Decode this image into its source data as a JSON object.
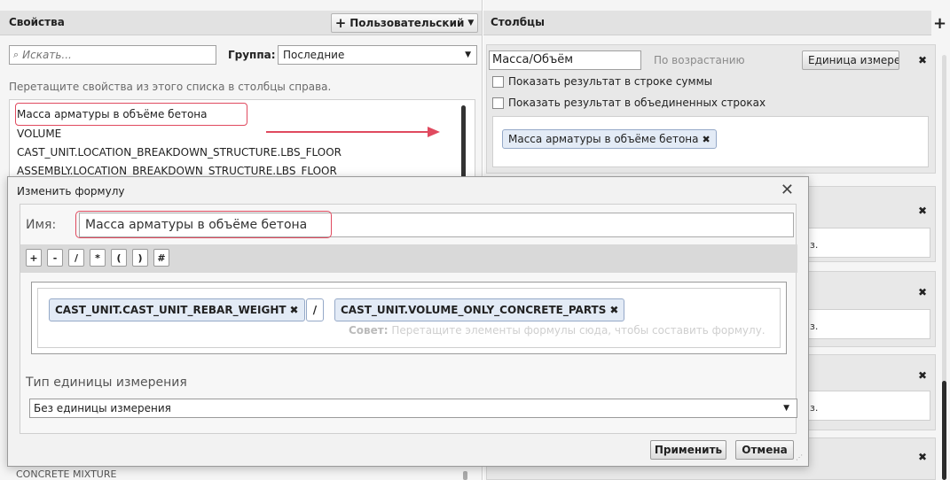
{
  "left": {
    "title": "Свойства",
    "custom_button": "Пользовательский",
    "search_placeholder": "Искать...",
    "group_label": "Группа:",
    "group_value": "Последние",
    "hint": "Перетащите свойства из этого списка в столбцы справа.",
    "items": [
      "Масса арматуры в объёме бетона",
      "VOLUME",
      "CAST_UNIT.LOCATION_BREAKDOWN_STRUCTURE.LBS_FLOOR",
      "ASSEMBLY.LOCATION_BREAKDOWN_STRUCTURE.LBS_FLOOR"
    ],
    "bottom_item": "CONCRETE MIXTURE"
  },
  "right": {
    "title": "Столбцы",
    "add_icon": "+",
    "column": {
      "name": "Масса/Объём",
      "sort": "По возрастанию",
      "unit_button": "Единица измере",
      "show_sum": "Показать результат в строке суммы",
      "show_merged": "Показать результат в объединенных строках",
      "chip": "Масса арматуры в объёме бетона"
    },
    "partial_cells": [
      "з.",
      "з.",
      "з."
    ]
  },
  "dialog": {
    "title": "Изменить формулу",
    "name_label": "Имя:",
    "name_value": "Масса арматуры в объёме бетона",
    "operators": [
      "+",
      "-",
      "/",
      "*",
      "(",
      ")",
      "#"
    ],
    "formula": {
      "left_chip": "CAST_UNIT.CAST_UNIT_REBAR_WEIGHT",
      "operator": "/",
      "right_chip": "CAST_UNIT.VOLUME_ONLY_CONCRETE_PARTS",
      "tip_prefix": "Совет:",
      "tip_text": "Перетащите элементы формулы сюда, чтобы составить формулу."
    },
    "unit_type_label": "Тип единицы измерения",
    "unit_value": "Без единицы измерения",
    "apply": "Применить",
    "cancel": "Отмена"
  },
  "colors": {
    "highlight": "#e04a5f",
    "chip_bg": "#e3ebf6"
  }
}
